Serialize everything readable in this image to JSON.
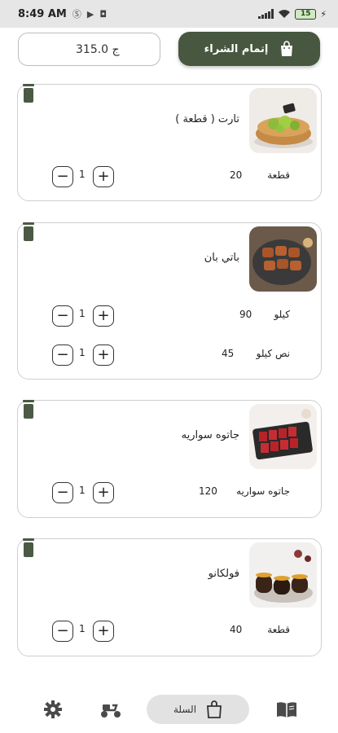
{
  "status_bar": {
    "time": "8:49 AM",
    "battery": "15"
  },
  "cart": {
    "total": "315.0 ج",
    "checkout_label": "إتمام الشراء"
  },
  "items": [
    {
      "name": "تارت ( قطعة )",
      "options": [
        {
          "unit": "قطعة",
          "price": "20",
          "qty": "1"
        }
      ]
    },
    {
      "name": "باتي بان",
      "options": [
        {
          "unit": "كيلو",
          "price": "90",
          "qty": "1"
        },
        {
          "unit": "نص كيلو",
          "price": "45",
          "qty": "1"
        }
      ]
    },
    {
      "name": "جاتوه سواريه",
      "options": [
        {
          "unit": "جاتوه سواريه",
          "price": "120",
          "qty": "1"
        }
      ]
    },
    {
      "name": "فولكانو",
      "options": [
        {
          "unit": "قطعة",
          "price": "40",
          "qty": "1"
        }
      ]
    }
  ],
  "nav": {
    "cart_label": "السلة",
    "icons": [
      "gear-icon",
      "delivery-scooter-icon",
      "shopping-bag-icon",
      "menu-book-icon"
    ]
  },
  "colors": {
    "primary": "#475740",
    "trash": "#4a5a44",
    "pill": "#e2e2e2"
  }
}
